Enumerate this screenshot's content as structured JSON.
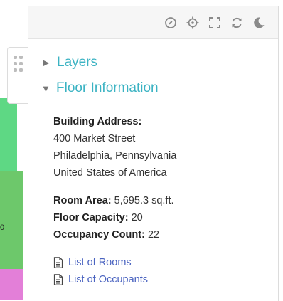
{
  "map": {
    "visible_label": "0"
  },
  "toolbar": {
    "icons": [
      "compass-icon",
      "crosshair-icon",
      "fullscreen-icon",
      "refresh-icon",
      "moon-icon"
    ]
  },
  "panel": {
    "layers_label": "Layers",
    "floor_info_label": "Floor Information",
    "building_address_label": "Building Address:",
    "address_line1": "400 Market Street",
    "address_line2": "Philadelphia, Pennsylvania",
    "address_line3": "United States of America",
    "room_area_label": "Room Area:",
    "room_area_value": "5,695.3 sq.ft.",
    "floor_capacity_label": "Floor Capacity:",
    "floor_capacity_value": "20",
    "occupancy_count_label": "Occupancy Count:",
    "occupancy_count_value": "22",
    "list_rooms": "List of Rooms",
    "list_occupants": "List of Occupants"
  },
  "colors": {
    "accent": "#3bb3c3",
    "link": "#4a63c0",
    "room_green": "#5ed884",
    "room_mid": "#6dc86b",
    "room_pink": "#e37fd8"
  }
}
